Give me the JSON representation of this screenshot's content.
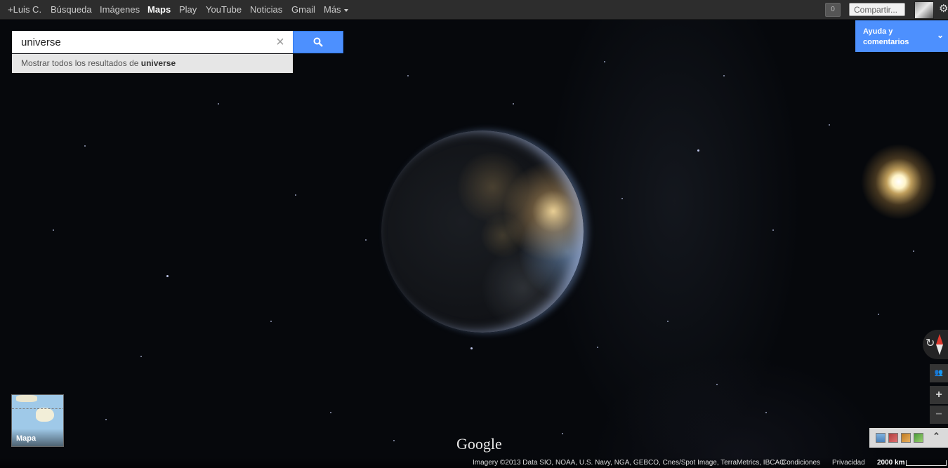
{
  "topbar": {
    "items": [
      {
        "label": "+Luis C."
      },
      {
        "label": "Búsqueda"
      },
      {
        "label": "Imágenes"
      },
      {
        "label": "Maps"
      },
      {
        "label": "Play"
      },
      {
        "label": "YouTube"
      },
      {
        "label": "Noticias"
      },
      {
        "label": "Gmail"
      },
      {
        "label": "Más"
      }
    ],
    "notifications_count": "0",
    "share_label": "Compartir..."
  },
  "search": {
    "value": "universe",
    "suggestion_prefix": "Mostrar todos los resultados de",
    "suggestion_term": "universe"
  },
  "help": {
    "label": "Ayuda y comentarios"
  },
  "minimap": {
    "label": "Mapa"
  },
  "map": {
    "logo": "Google"
  },
  "footer": {
    "imagery": "Imagery ©2013 Data SIO, NOAA, U.S. Navy, NGA, GEBCO, Cnes/Spot Image, TerraMetrics, IBCAO",
    "terms": "Condiciones",
    "privacy": "Privacidad",
    "scale": "2000 km"
  },
  "colors": {
    "accent": "#4d90fe",
    "topbar": "#2d2d2d"
  }
}
